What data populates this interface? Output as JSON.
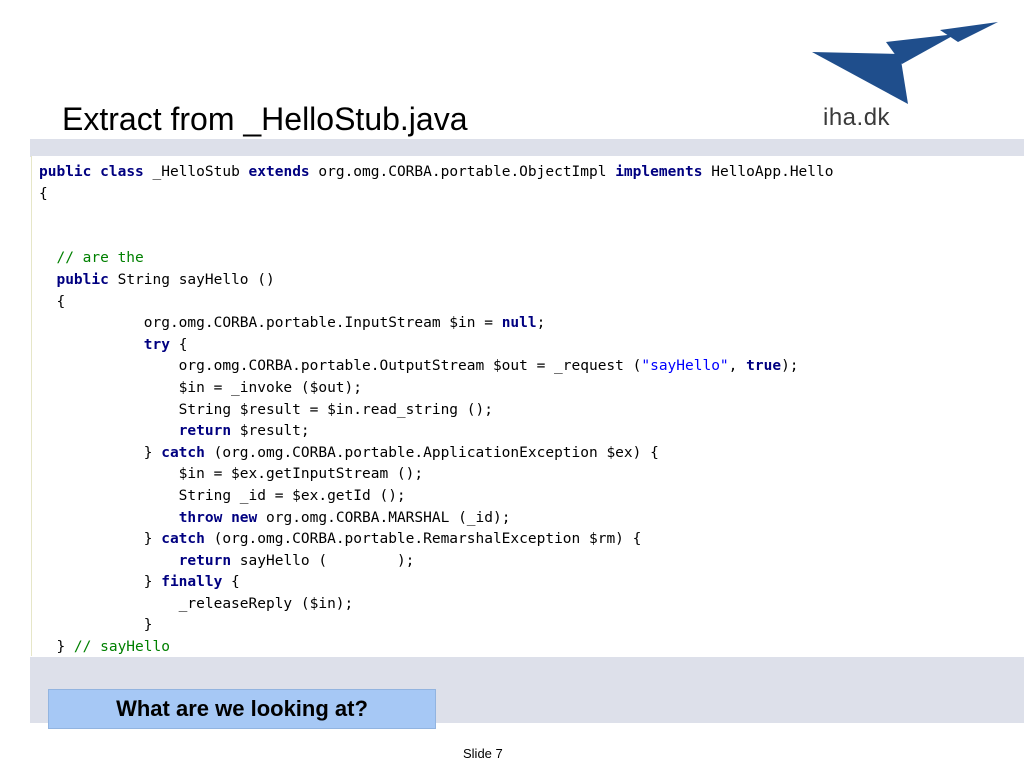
{
  "slide": {
    "title": "Extract from _HelloStub.java",
    "logo_text": "iha.dk",
    "logo_icon": "iha-wing-logo",
    "question": "What are we looking at?",
    "slide_number": "Slide 7"
  },
  "colors": {
    "band": "#dde0ea",
    "question_box": "#a6c8f5",
    "logo_blue": "#1f4e8c",
    "keyword": "#000080",
    "comment": "#008000",
    "string": "#0000ff"
  },
  "code": {
    "language": "java",
    "lines": [
      [
        [
          "kw",
          "public"
        ],
        [
          "t",
          " "
        ],
        [
          "kw",
          "class"
        ],
        [
          "t",
          " _HelloStub "
        ],
        [
          "kw",
          "extends"
        ],
        [
          "t",
          " org.omg.CORBA.portable.ObjectImpl "
        ],
        [
          "kw",
          "implements"
        ],
        [
          "t",
          " HelloApp.Hello"
        ]
      ],
      [
        [
          "t",
          "{"
        ]
      ],
      [],
      [],
      [
        [
          "t",
          "  "
        ],
        [
          "cm",
          "// are the"
        ]
      ],
      [
        [
          "t",
          "  "
        ],
        [
          "kw",
          "public"
        ],
        [
          "t",
          " String sayHello ()"
        ]
      ],
      [
        [
          "t",
          "  {"
        ]
      ],
      [
        [
          "t",
          "            org.omg.CORBA.portable.InputStream $in = "
        ],
        [
          "kw",
          "null"
        ],
        [
          "t",
          ";"
        ]
      ],
      [
        [
          "t",
          "            "
        ],
        [
          "kw",
          "try"
        ],
        [
          "t",
          " {"
        ]
      ],
      [
        [
          "t",
          "                org.omg.CORBA.portable.OutputStream $out = _request ("
        ],
        [
          "st",
          "\"sayHello\""
        ],
        [
          "t",
          ", "
        ],
        [
          "kw",
          "true"
        ],
        [
          "t",
          ");"
        ]
      ],
      [
        [
          "t",
          "                $in = _invoke ($out);"
        ]
      ],
      [
        [
          "t",
          "                String $result = $in.read_string ();"
        ]
      ],
      [
        [
          "t",
          "                "
        ],
        [
          "kw",
          "return"
        ],
        [
          "t",
          " $result;"
        ]
      ],
      [
        [
          "t",
          "            } "
        ],
        [
          "kw",
          "catch"
        ],
        [
          "t",
          " (org.omg.CORBA.portable.ApplicationException $ex) {"
        ]
      ],
      [
        [
          "t",
          "                $in = $ex.getInputStream ();"
        ]
      ],
      [
        [
          "t",
          "                String _id = $ex.getId ();"
        ]
      ],
      [
        [
          "t",
          "                "
        ],
        [
          "kw",
          "throw"
        ],
        [
          "t",
          " "
        ],
        [
          "kw",
          "new"
        ],
        [
          "t",
          " org.omg.CORBA.MARSHAL (_id);"
        ]
      ],
      [
        [
          "t",
          "            } "
        ],
        [
          "kw",
          "catch"
        ],
        [
          "t",
          " (org.omg.CORBA.portable.RemarshalException $rm) {"
        ]
      ],
      [
        [
          "t",
          "                "
        ],
        [
          "kw",
          "return"
        ],
        [
          "t",
          " sayHello (        );"
        ]
      ],
      [
        [
          "t",
          "            } "
        ],
        [
          "kw",
          "finally"
        ],
        [
          "t",
          " {"
        ]
      ],
      [
        [
          "t",
          "                _releaseReply ($in);"
        ]
      ],
      [
        [
          "t",
          "            }"
        ]
      ],
      [
        [
          "t",
          "  } "
        ],
        [
          "cm",
          "// sayHello"
        ]
      ]
    ]
  }
}
